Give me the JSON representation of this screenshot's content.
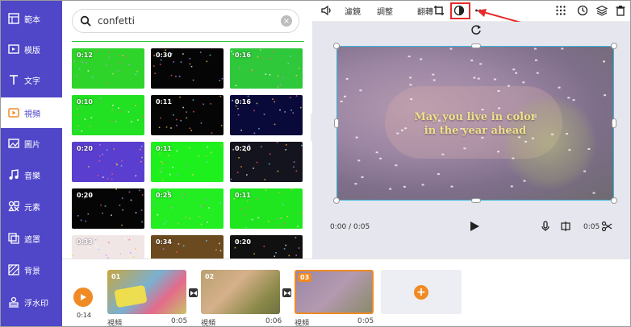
{
  "sidebar": {
    "items": [
      {
        "label": "範本",
        "icon": "template-icon"
      },
      {
        "label": "模版",
        "icon": "layout-icon"
      },
      {
        "label": "文字",
        "icon": "text-icon"
      },
      {
        "label": "視頻",
        "icon": "video-icon",
        "active": true
      },
      {
        "label": "圖片",
        "icon": "image-icon"
      },
      {
        "label": "音樂",
        "icon": "music-icon"
      },
      {
        "label": "元素",
        "icon": "elements-icon"
      },
      {
        "label": "遮罩",
        "icon": "mask-icon"
      },
      {
        "label": "背景",
        "icon": "background-icon"
      },
      {
        "label": "浮水印",
        "icon": "watermark-icon"
      }
    ]
  },
  "search": {
    "value": "confetti",
    "icon": "search-icon",
    "clear_icon": "clear-icon"
  },
  "results": [
    {
      "duration": "0:12",
      "bg": "#2fd42a"
    },
    {
      "duration": "0:30",
      "bg": "#050505"
    },
    {
      "duration": "0:16",
      "bg": "#2ec83a"
    },
    {
      "duration": "0:10",
      "bg": "#22e022"
    },
    {
      "duration": "0:11",
      "bg": "#050505"
    },
    {
      "duration": "0:16",
      "bg": "#0a0a3a"
    },
    {
      "duration": "0:20",
      "bg": "#5a3ecf"
    },
    {
      "duration": "0:11",
      "bg": "#1ef01e"
    },
    {
      "duration": "0:20",
      "bg": "#14141e"
    },
    {
      "duration": "0:20",
      "bg": "#050505"
    },
    {
      "duration": "0:25",
      "bg": "#22ee22"
    },
    {
      "duration": "0:11",
      "bg": "#20e620"
    },
    {
      "duration": "0:33",
      "bg": "#f1e6e6"
    },
    {
      "duration": "0:34",
      "bg": "#6b4a20"
    },
    {
      "duration": "0:20",
      "bg": "#101010"
    }
  ],
  "toolbar": {
    "volume_icon": "volume-icon",
    "filter": "濾鏡",
    "adjust": "調整",
    "flip": "翻轉",
    "crop_icon": "crop-icon",
    "effect_icon": "effect-icon",
    "more_icon": "more-icon",
    "grid_icon": "grid-icon",
    "history_icon": "history-icon",
    "layers_icon": "layers-icon",
    "delete_icon": "delete-icon"
  },
  "canvas": {
    "caption_line1": "May you live in color",
    "caption_line2": "in the year ahead"
  },
  "player": {
    "time": "0:00 / 0:05",
    "duration": "0:05"
  },
  "timeline": {
    "total_time": "0:14",
    "clips": [
      {
        "num": "01",
        "label": "視頻",
        "duration": "0:05"
      },
      {
        "num": "02",
        "label": "視頻",
        "duration": "0:06"
      },
      {
        "num": "03",
        "label": "視頻",
        "duration": "0:05"
      }
    ]
  },
  "colors": {
    "accent": "#f08a24",
    "sidebar": "#4f46c8",
    "highlight": "#e52b2b"
  }
}
